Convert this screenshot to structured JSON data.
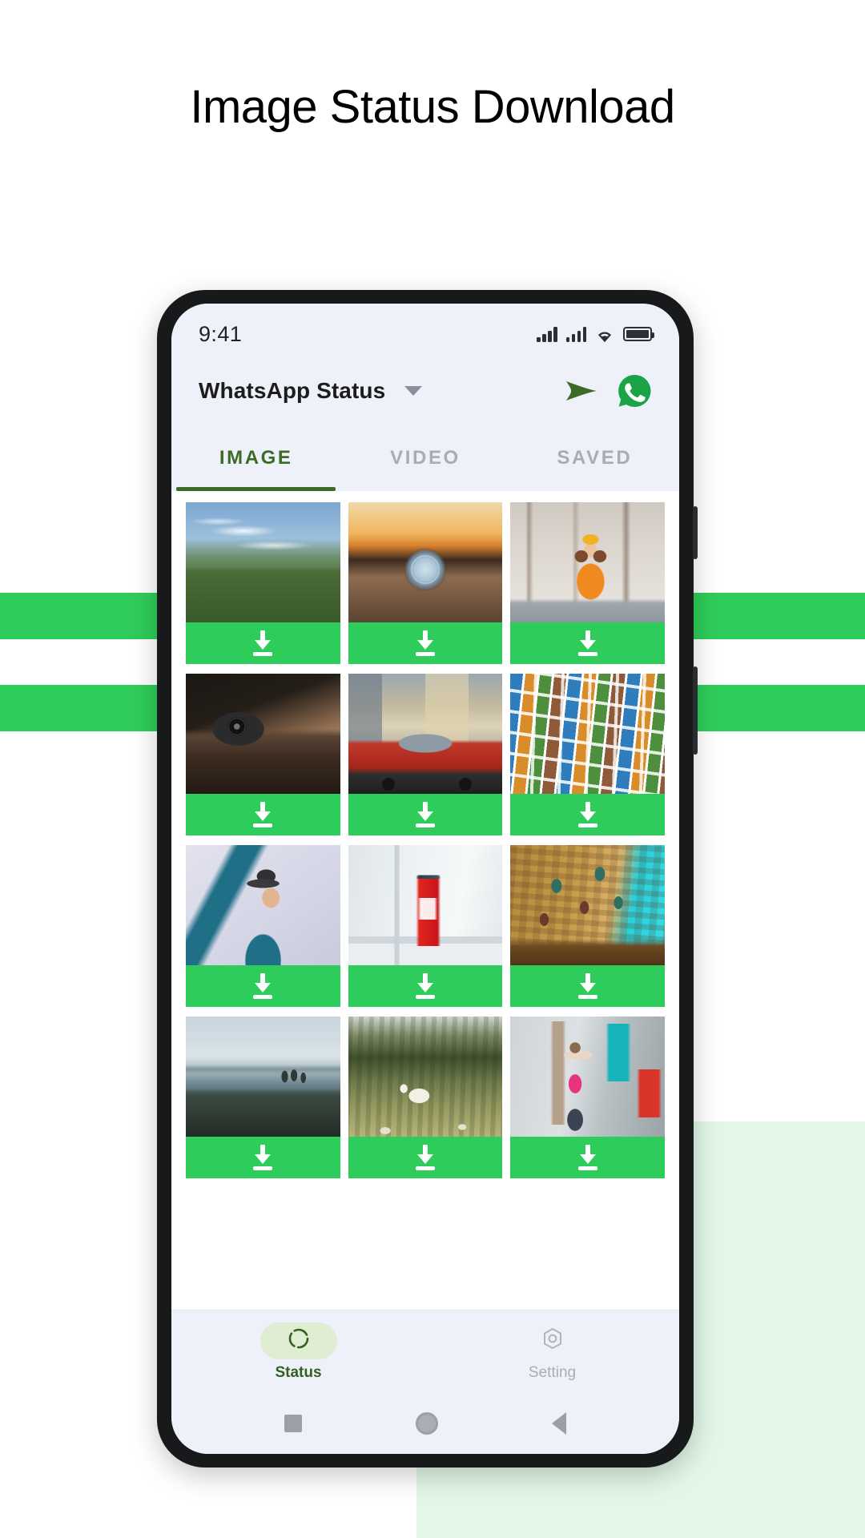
{
  "heading": "Image Status Download",
  "colors": {
    "accent_green": "#2ecc5a",
    "dark_green": "#3d6b26",
    "mint_blob": "#e2f7e8",
    "status_bg": "#eef1f9"
  },
  "phone": {
    "statusbar": {
      "clock": "9:41",
      "icons": [
        "signal-bars-icon",
        "signal-bars-icon",
        "wifi-icon",
        "battery-icon"
      ]
    },
    "appbar": {
      "title": "WhatsApp Status",
      "dropdown_icon": "chevron-down-icon",
      "actions": [
        {
          "name": "send-icon",
          "label": "Send"
        },
        {
          "name": "whatsapp-icon",
          "label": "WhatsApp"
        }
      ]
    },
    "tabs": [
      {
        "label": "IMAGE",
        "active": true
      },
      {
        "label": "VIDEO",
        "active": false
      },
      {
        "label": "SAVED",
        "active": false
      }
    ],
    "grid": {
      "download_icon": "download-icon",
      "items": [
        {
          "alt": "Green mountain peak under blue sky"
        },
        {
          "alt": "Glass sphere on sand at sunset"
        },
        {
          "alt": "Girl in orange jacket sitting in snow"
        },
        {
          "alt": "Vintage film camera on a book"
        },
        {
          "alt": "Red jeep parked on a city street"
        },
        {
          "alt": "Wall of travel postcards"
        },
        {
          "alt": "Boy in teal shirt wearing a hat"
        },
        {
          "alt": "Coca-Cola Zero can on a windowsill"
        },
        {
          "alt": "Old stone building with green shutters"
        },
        {
          "alt": "People on rocky coast by the sea"
        },
        {
          "alt": "White horse in a grassy field"
        },
        {
          "alt": "Girl in pink top with arms outstretched"
        }
      ]
    },
    "bottomnav": [
      {
        "label": "Status",
        "icon": "status-ring-icon",
        "active": true
      },
      {
        "label": "Setting",
        "icon": "gear-icon",
        "active": false
      }
    ],
    "androidnav": [
      {
        "name": "recents-button",
        "icon": "square-icon"
      },
      {
        "name": "home-button",
        "icon": "circle-icon"
      },
      {
        "name": "back-button",
        "icon": "triangle-left-icon"
      }
    ]
  }
}
